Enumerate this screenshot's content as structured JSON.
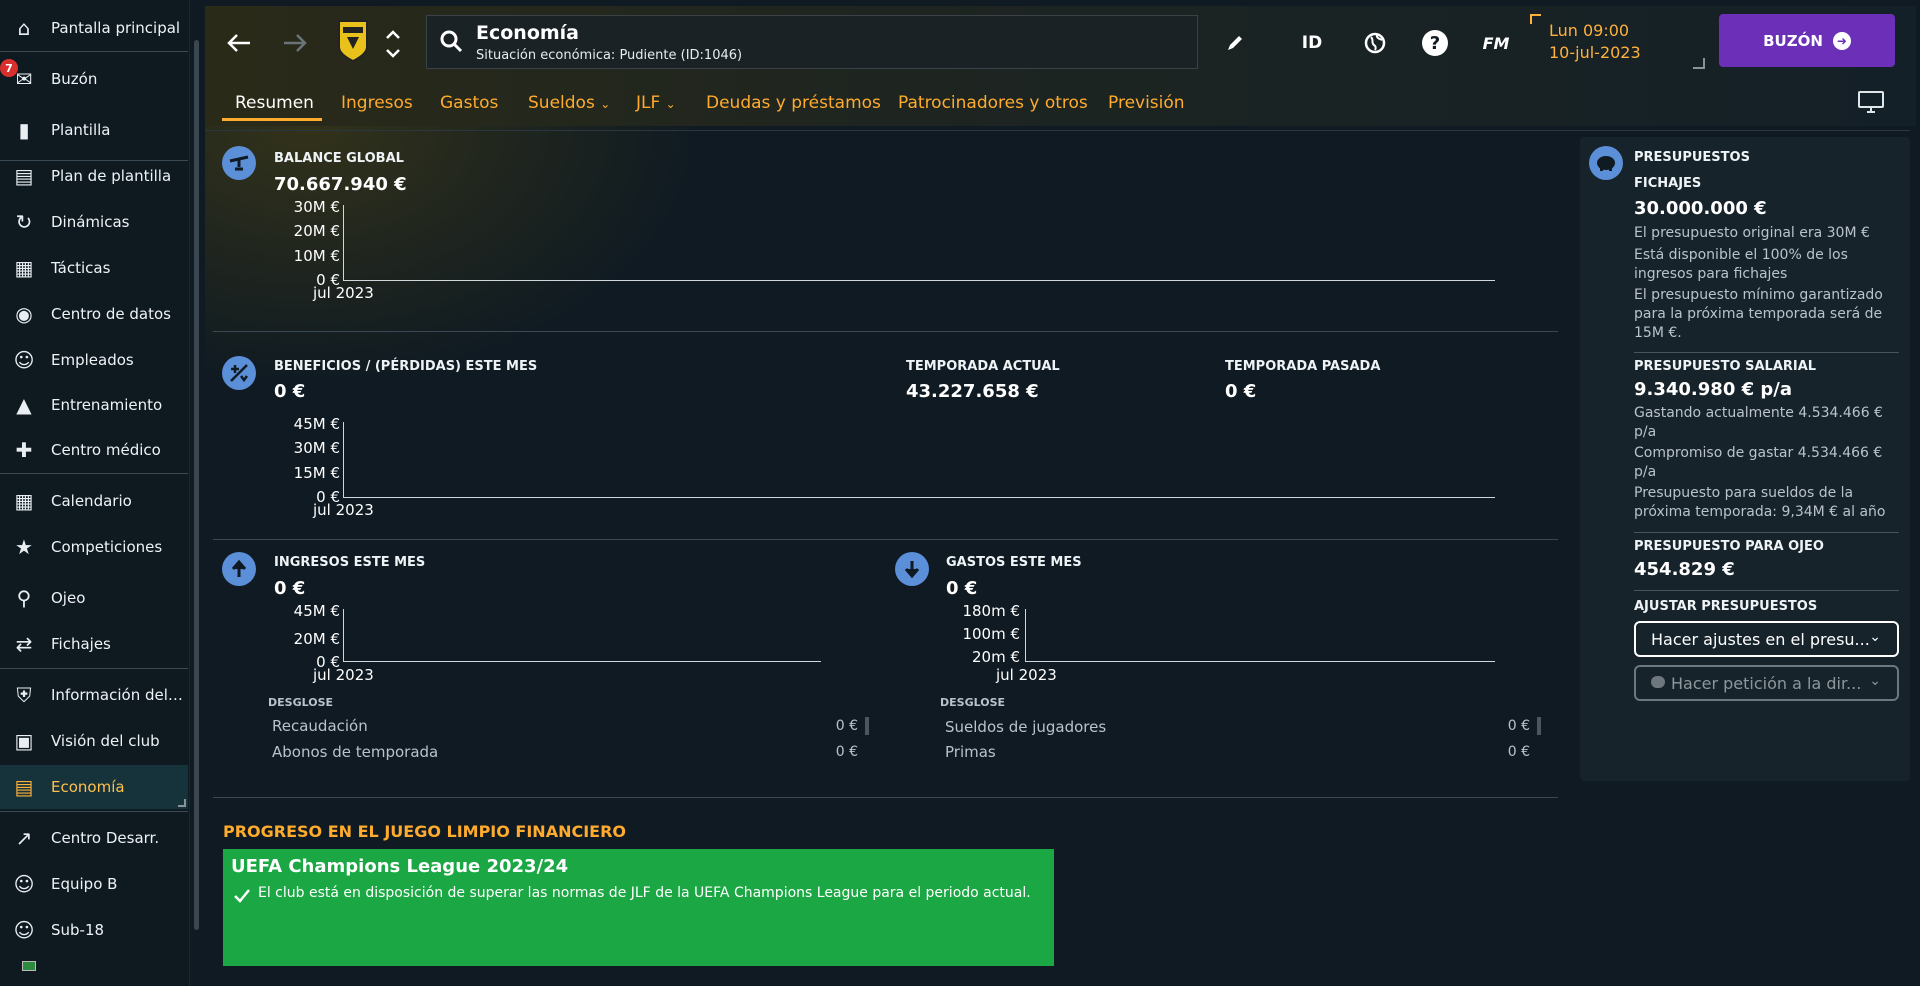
{
  "sidebar": {
    "items": [
      {
        "label": "Pantalla principal",
        "icon": "home-icon"
      },
      {
        "label": "Buzón",
        "icon": "inbox-icon",
        "badge": "7"
      },
      {
        "label": "Plantilla",
        "icon": "shirt-icon"
      },
      {
        "label": "Plan de plantilla",
        "icon": "clipboard-icon"
      },
      {
        "label": "Dinámicas",
        "icon": "dynamics-icon"
      },
      {
        "label": "Tácticas",
        "icon": "tactics-icon"
      },
      {
        "label": "Centro de datos",
        "icon": "data-hub-icon"
      },
      {
        "label": "Empleados",
        "icon": "staff-icon"
      },
      {
        "label": "Entrenamiento",
        "icon": "training-cone-icon"
      },
      {
        "label": "Centro médico",
        "icon": "medical-kit-icon"
      },
      {
        "label": "Calendario",
        "icon": "calendar-icon"
      },
      {
        "label": "Competiciones",
        "icon": "trophy-icon"
      },
      {
        "label": "Ojeo",
        "icon": "magnifier-icon"
      },
      {
        "label": "Fichajes",
        "icon": "transfer-icon"
      },
      {
        "label": "Información del cl...",
        "icon": "club-shield-icon"
      },
      {
        "label": "Visión del club",
        "icon": "briefcase-icon"
      },
      {
        "label": "Economía",
        "icon": "money-icon",
        "active": true
      },
      {
        "label": "Centro Desarr.",
        "icon": "growth-icon"
      },
      {
        "label": "Equipo B",
        "icon": "team-b-icon"
      },
      {
        "label": "Sub-18",
        "icon": "u18-icon"
      }
    ]
  },
  "header": {
    "search_title": "Economía",
    "search_subtitle": "Situación económica: Pudiente (ID:1046)",
    "id_label": "ID",
    "fm_label": "FM",
    "date_line1": "Lun 09:00",
    "date_line2": "10-jul-2023",
    "inbox_button": "BUZÓN"
  },
  "tabs": [
    "Resumen",
    "Ingresos",
    "Gastos",
    "Sueldos",
    "JLF",
    "Deudas y préstamos",
    "Patrocinadores y otros",
    "Previsión"
  ],
  "balance": {
    "title": "BALANCE GLOBAL",
    "value": "70.667.940 €",
    "y_ticks": [
      "30M €",
      "20M €",
      "10M €",
      "0 €"
    ],
    "x_label": "jul 2023"
  },
  "profit": {
    "title": "BENEFICIOS / (PÉRDIDAS) ESTE MES",
    "value": "0 €",
    "current_season_title": "TEMPORADA ACTUAL",
    "current_season_value": "43.227.658 €",
    "last_season_title": "TEMPORADA PASADA",
    "last_season_value": "0 €",
    "y_ticks": [
      "45M €",
      "30M €",
      "15M €",
      "0 €"
    ],
    "x_label": "jul 2023"
  },
  "income": {
    "title": "INGRESOS ESTE MES",
    "value": "0 €",
    "y_ticks": [
      "45M €",
      "20M €",
      "0 €"
    ],
    "x_label": "jul 2023",
    "breakdown_title": "DESGLOSE",
    "rows": [
      {
        "label": "Recaudación",
        "value": "0 €"
      },
      {
        "label": "Abonos de temporada",
        "value": "0 €"
      }
    ]
  },
  "expenses": {
    "title": "GASTOS ESTE MES",
    "value": "0 €",
    "y_ticks": [
      "180m €",
      "100m €",
      "20m €"
    ],
    "x_label": "jul 2023",
    "breakdown_title": "DESGLOSE",
    "rows": [
      {
        "label": "Sueldos de jugadores",
        "value": "0 €"
      },
      {
        "label": "Primas",
        "value": "0 €"
      }
    ]
  },
  "budgets": {
    "title": "PRESUPUESTOS",
    "transfers_title": "FICHAJES",
    "transfers_value": "30.000.000 €",
    "transfers_note1": "El presupuesto original era 30M €",
    "transfers_note2": "Está disponible el 100% de los ingresos para fichajes",
    "transfers_note3": "El presupuesto mínimo garantizado para la próxima temporada será de 15M €.",
    "wage_title": "PRESUPUESTO SALARIAL",
    "wage_value": "9.340.980 € p/a",
    "wage_note1": "Gastando actualmente 4.534.466 € p/a",
    "wage_note2": "Compromiso de gastar 4.534.466 € p/a",
    "wage_note3": "Presupuesto para sueldos de la próxima temporada: 9,34M € al año",
    "scouting_title": "PRESUPUESTO PARA OJEO",
    "scouting_value": "454.829 €",
    "adjust_title": "AJUSTAR PRESUPUESTOS",
    "adjust_button": "Hacer ajustes en el presu...",
    "request_button": "Hacer petición a la dir..."
  },
  "ffp": {
    "title": "PROGRESO EN EL JUEGO LIMPIO FINANCIERO",
    "competition": "UEFA Champions League 2023/24",
    "message": "El club está en disposición de superar las normas de JLF de la UEFA Champions League para el periodo actual."
  }
}
